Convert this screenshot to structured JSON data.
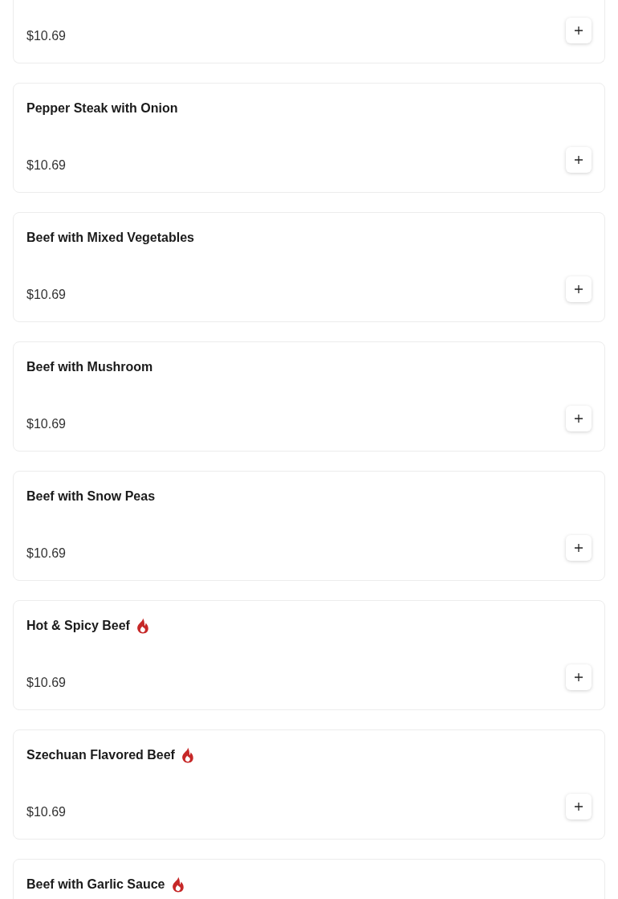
{
  "items": [
    {
      "price": "$10.69"
    },
    {
      "name": "Pepper Steak with Onion",
      "price": "$10.69",
      "spicy": false
    },
    {
      "name": "Beef with Mixed Vegetables",
      "price": "$10.69",
      "spicy": false
    },
    {
      "name": "Beef with Mushroom",
      "price": "$10.69",
      "spicy": false
    },
    {
      "name": "Beef with Snow Peas",
      "price": "$10.69",
      "spicy": false
    },
    {
      "name": "Hot & Spicy Beef",
      "price": "$10.69",
      "spicy": true
    },
    {
      "name": "Szechuan Flavored Beef",
      "price": "$10.69",
      "spicy": true
    },
    {
      "name": "Beef with Garlic Sauce",
      "spicy": true
    }
  ]
}
